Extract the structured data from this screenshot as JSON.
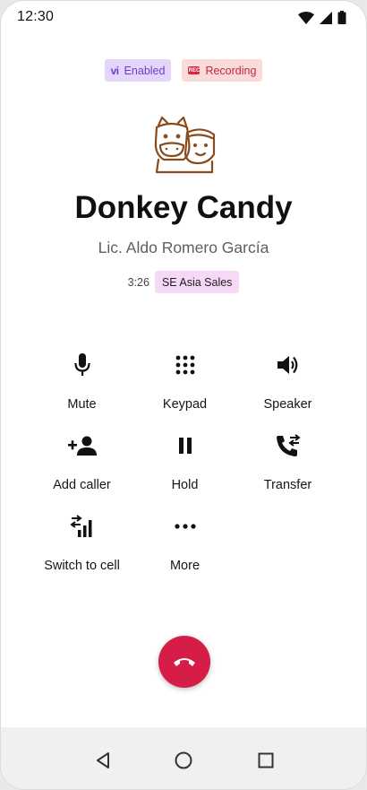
{
  "status_bar": {
    "time": "12:30",
    "icons": [
      "wifi-icon",
      "cell-signal-icon",
      "battery-icon"
    ]
  },
  "badges": {
    "enabled": {
      "mark": "vi",
      "label": "Enabled"
    },
    "recording": {
      "mark": "REC",
      "label": "Recording"
    }
  },
  "caller": {
    "name": "Donkey Candy",
    "subtitle": "Lic. Aldo Romero García",
    "timer": "3:26",
    "queue": "SE Asia Sales"
  },
  "controls": [
    {
      "label": "Mute",
      "icon": "microphone-icon"
    },
    {
      "label": "Keypad",
      "icon": "keypad-icon"
    },
    {
      "label": "Speaker",
      "icon": "speaker-icon"
    },
    {
      "label": "Add caller",
      "icon": "add-person-icon"
    },
    {
      "label": "Hold",
      "icon": "pause-icon"
    },
    {
      "label": "Transfer",
      "icon": "phone-transfer-icon"
    },
    {
      "label": "Switch to cell",
      "icon": "switch-to-cell-icon"
    },
    {
      "label": "More",
      "icon": "more-icon"
    }
  ],
  "end_call": {
    "icon": "hang-up-icon"
  },
  "nav": {
    "icons": [
      "back-icon",
      "home-icon",
      "recents-icon"
    ]
  },
  "colors": {
    "end_call": "#d51d48",
    "enabled_bg": "#e4d6fb",
    "recording_bg": "#fbdada",
    "queue_bg": "#f6d8f7",
    "logo_stroke": "#8a4b1c"
  }
}
